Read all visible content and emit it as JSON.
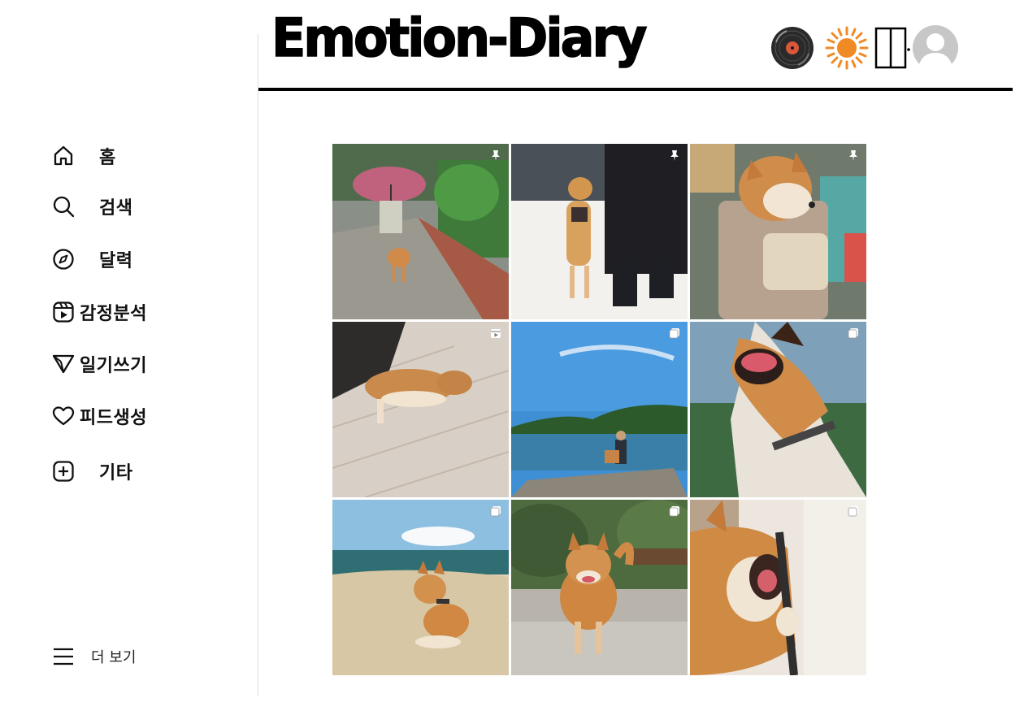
{
  "app": {
    "title": "Emotion-Diary"
  },
  "sidebar": {
    "items": [
      {
        "label": "홈",
        "icon": "home-icon"
      },
      {
        "label": "검색",
        "icon": "search-icon"
      },
      {
        "label": "달력",
        "icon": "compass-icon"
      },
      {
        "label": "감정분석",
        "icon": "reels-icon"
      },
      {
        "label": "일기쓰기",
        "icon": "send-icon"
      },
      {
        "label": "피드생성",
        "icon": "heart-icon"
      },
      {
        "label": "기타",
        "icon": "plus-square-icon"
      }
    ],
    "more_label": "더 보기"
  },
  "header": {
    "icons": [
      "vinyl-record-icon",
      "sun-icon",
      "door-icon",
      "profile-avatar-icon"
    ]
  },
  "feed": {
    "posts": [
      {
        "subject": "shiba walking with person holding pink umbrella",
        "badge": "pin-icon"
      },
      {
        "subject": "shiba standing on hind legs in snow",
        "badge": "pin-icon"
      },
      {
        "subject": "shiba in carrier bag",
        "badge": "pin-icon"
      },
      {
        "subject": "shiba sleeping on wooden floor",
        "badge": "reels-badge-icon"
      },
      {
        "subject": "person and dog by the lake",
        "badge": "carousel-icon"
      },
      {
        "subject": "shiba barking with open mouth",
        "badge": "carousel-icon"
      },
      {
        "subject": "shiba lying on beach",
        "badge": "carousel-icon"
      },
      {
        "subject": "smiling shiba on gravel",
        "badge": "carousel-icon"
      },
      {
        "subject": "shiba biting a stick",
        "badge": "carousel-icon"
      }
    ]
  },
  "colors": {
    "accent_sun": "#f08a24",
    "divider": "#dbdbdb",
    "header_rule": "#000000"
  }
}
